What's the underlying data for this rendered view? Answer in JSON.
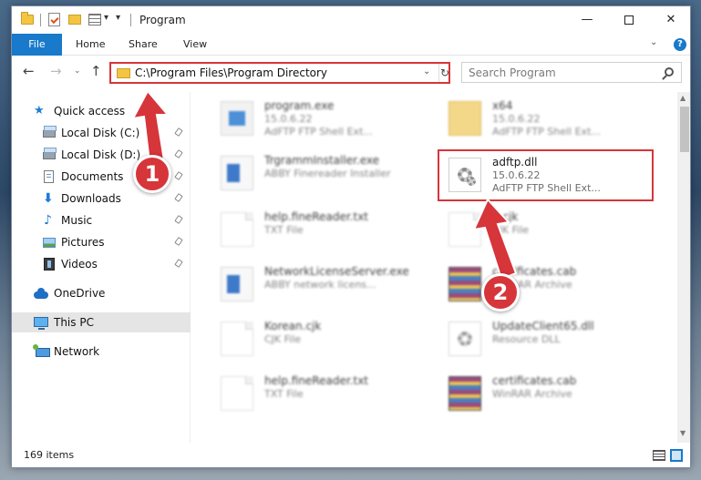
{
  "window": {
    "title": "Program",
    "controls": {
      "minimize": "—",
      "maximize": "",
      "close": "✕"
    }
  },
  "ribbon": {
    "tabs": [
      {
        "label": "File",
        "active": true
      },
      {
        "label": "Home"
      },
      {
        "label": "Share"
      },
      {
        "label": "View"
      }
    ],
    "help": "?",
    "accent": "#1979ca"
  },
  "nav": {
    "back": "←",
    "forward": "→",
    "recent": "⌄",
    "up": "↑",
    "address": "C:\\Program Files\\Program Directory",
    "address_dropdown": "⌄",
    "refresh": "↻",
    "search_placeholder": "Search Program"
  },
  "sidebar": {
    "items": [
      {
        "label": "Quick access",
        "icon": "star-icon",
        "pinned": false
      },
      {
        "label": "Local Disk (C:)",
        "icon": "disk-icon",
        "pinned": true
      },
      {
        "label": "Local Disk (D:)",
        "icon": "disk-icon",
        "pinned": true
      },
      {
        "label": "Documents",
        "icon": "documents-icon",
        "pinned": true
      },
      {
        "label": "Downloads",
        "icon": "download-icon",
        "pinned": true
      },
      {
        "label": "Music",
        "icon": "music-icon",
        "pinned": true
      },
      {
        "label": "Pictures",
        "icon": "pictures-icon",
        "pinned": true
      },
      {
        "label": "Videos",
        "icon": "videos-icon",
        "pinned": true
      },
      {
        "label": "OneDrive",
        "icon": "cloud-icon",
        "pinned": false
      },
      {
        "label": "This PC",
        "icon": "computer-icon",
        "pinned": false,
        "selected": true
      },
      {
        "label": "Network",
        "icon": "network-icon",
        "pinned": false
      }
    ]
  },
  "files": [
    {
      "name": "program.exe",
      "sub1": "15.0.6.22",
      "sub2": "AdFTP FTP Shell Ext...",
      "type": "exe",
      "blurred": true
    },
    {
      "name": "x64",
      "sub1": "15.0.6.22",
      "sub2": "AdFTP FTP Shell Ext...",
      "type": "folder",
      "blurred": true
    },
    {
      "name": "TrgrammInstaller.exe",
      "sub1": "ABBY Finereader Installer",
      "sub2": "",
      "type": "installer",
      "blurred": true
    },
    {
      "name": "adftp.dll",
      "sub1": "15.0.6.22",
      "sub2": "AdFTP FTP Shell Ext...",
      "type": "dll",
      "blurred": false
    },
    {
      "name": "help.fineReader.txt",
      "sub1": "TXT File",
      "sub2": "",
      "type": "txt",
      "blurred": true
    },
    {
      "name": "...cjk",
      "sub1": "CJK File",
      "sub2": "",
      "type": "txt",
      "blurred": true
    },
    {
      "name": "NetworkLicenseServer.exe",
      "sub1": "ABBY network licens...",
      "sub2": "",
      "type": "installer",
      "blurred": true
    },
    {
      "name": "certificates.cab",
      "sub1": "WinRAR Archive",
      "sub2": "",
      "type": "rar",
      "blurred": true
    },
    {
      "name": "Korean.cjk",
      "sub1": "CJK File",
      "sub2": "",
      "type": "txt",
      "blurred": true
    },
    {
      "name": "UpdateClient65.dll",
      "sub1": "Resource DLL",
      "sub2": "",
      "type": "dll",
      "blurred": true
    },
    {
      "name": "help.fineReader.txt",
      "sub1": "TXT File",
      "sub2": "",
      "type": "txt",
      "blurred": true
    },
    {
      "name": "certificates.cab",
      "sub1": "WinRAR Archive",
      "sub2": "",
      "type": "rar",
      "blurred": true
    }
  ],
  "status": {
    "items_count": "169 items"
  },
  "annotations": {
    "step1": "1",
    "step2": "2",
    "highlight_color": "#d6353a"
  }
}
